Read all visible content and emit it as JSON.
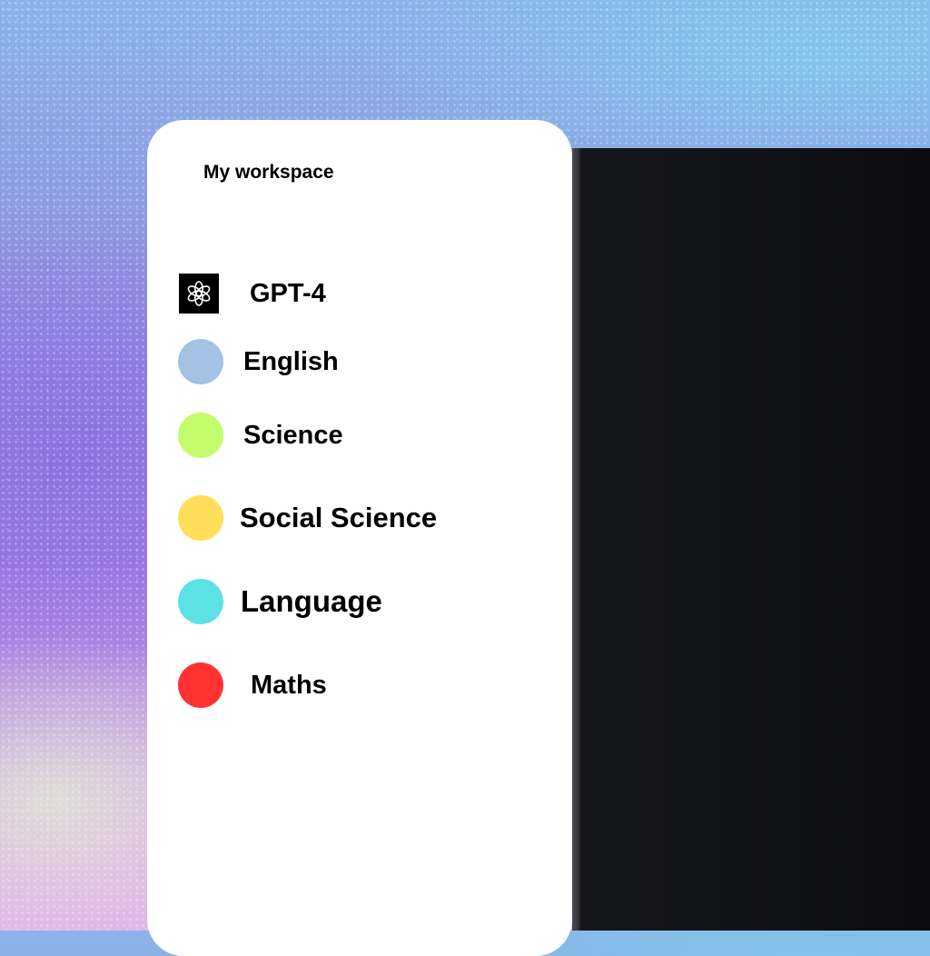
{
  "workspace": {
    "title": "My workspace",
    "items": [
      {
        "label": "GPT-4",
        "icon": "openai-logo-icon",
        "color": "#000000"
      },
      {
        "label": "English",
        "icon": "dot-icon",
        "color": "#a4c2e3"
      },
      {
        "label": "Science",
        "icon": "dot-icon",
        "color": "#c3fd6c"
      },
      {
        "label": "Social Science",
        "icon": "dot-icon",
        "color": "#ffde59"
      },
      {
        "label": "Language",
        "icon": "dot-icon",
        "color": "#5ce1e6"
      },
      {
        "label": "Maths",
        "icon": "dot-icon",
        "color": "#ff3131"
      }
    ]
  },
  "colors": {
    "card": "#ffffff",
    "dark_panel": "#111217"
  }
}
